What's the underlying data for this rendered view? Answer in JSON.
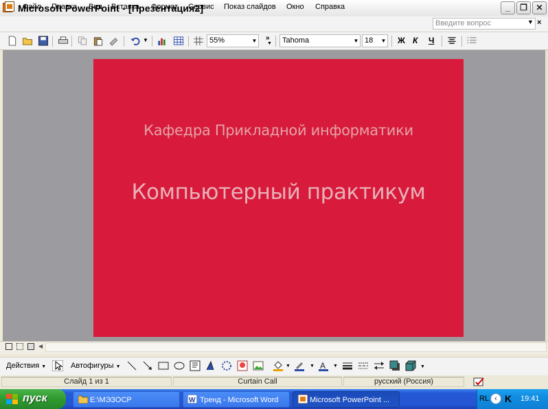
{
  "window": {
    "title": "Microsoft PowerPoint - [Презентация2]",
    "minimize": "_",
    "maximize": "❐",
    "close": "✕"
  },
  "menu": {
    "items": [
      "Файл",
      "Правка",
      "Вид",
      "Вставка",
      "Формат",
      "Сервис",
      "Показ слайдов",
      "Окно",
      "Справка"
    ],
    "help_placeholder": "Введите вопрос",
    "close_glyph": "×"
  },
  "toolbar": {
    "zoom": "55%",
    "font": "Tahoma",
    "font_size": "18",
    "bold": "Ж",
    "italic": "К",
    "underline": "Ч"
  },
  "slide": {
    "subtitle": "Кафедра Прикладной информатики",
    "title": "Компьютерный практикум",
    "background": "#d81a3c"
  },
  "drawing": {
    "actions": "Действия",
    "autoshapes": "Автофигуры"
  },
  "status": {
    "slide": "Слайд 1 из 1",
    "design": "Curtain Call",
    "language": "русский (Россия)"
  },
  "taskbar": {
    "start": "пуск",
    "tasks": [
      {
        "label": "E:\\МЭЗОСР",
        "active": false,
        "icon": "folder-icon"
      },
      {
        "label": "Тренд - Microsoft Word",
        "active": false,
        "icon": "word-icon"
      },
      {
        "label": "Microsoft PowerPoint ...",
        "active": true,
        "icon": "powerpoint-icon"
      }
    ],
    "lang": "RL",
    "clock": "19:41"
  },
  "colors": {
    "taskbar": "#2454d2",
    "start": "#2e9a2e",
    "workspace": "#9c9ca0"
  }
}
